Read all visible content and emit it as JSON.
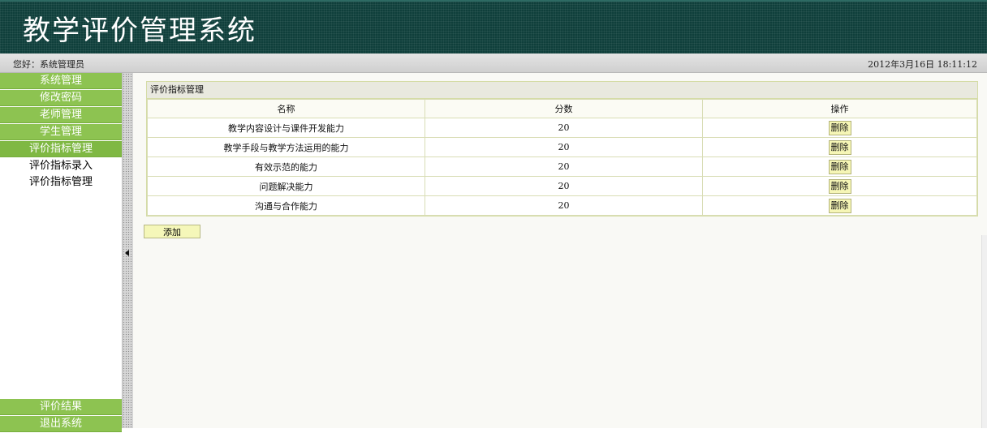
{
  "header": {
    "title": "教学评价管理系统"
  },
  "userbar": {
    "greeting": "您好：系统管理员",
    "datetime": "2012年3月16日  18:11:12"
  },
  "sidebar": {
    "items": [
      {
        "label": "系统管理"
      },
      {
        "label": "修改密码"
      },
      {
        "label": "老师管理"
      },
      {
        "label": "学生管理"
      },
      {
        "label": "评价指标管理"
      }
    ],
    "subitems": [
      {
        "label": "评价指标录入"
      },
      {
        "label": "评价指标管理"
      }
    ],
    "bottom_items": [
      {
        "label": "评价结果"
      },
      {
        "label": "退出系统"
      }
    ]
  },
  "panel": {
    "title": "评价指标管理",
    "columns": [
      "名称",
      "分数",
      "操作"
    ],
    "rows": [
      {
        "name": "教学内容设计与课件开发能力",
        "score": "20",
        "action": "删除"
      },
      {
        "name": "教学手段与教学方法运用的能力",
        "score": "20",
        "action": "删除"
      },
      {
        "name": "有效示范的能力",
        "score": "20",
        "action": "删除"
      },
      {
        "name": "问题解决能力",
        "score": "20",
        "action": "删除"
      },
      {
        "name": "沟通与合作能力",
        "score": "20",
        "action": "删除"
      }
    ]
  },
  "add_button": {
    "label": "添加"
  }
}
